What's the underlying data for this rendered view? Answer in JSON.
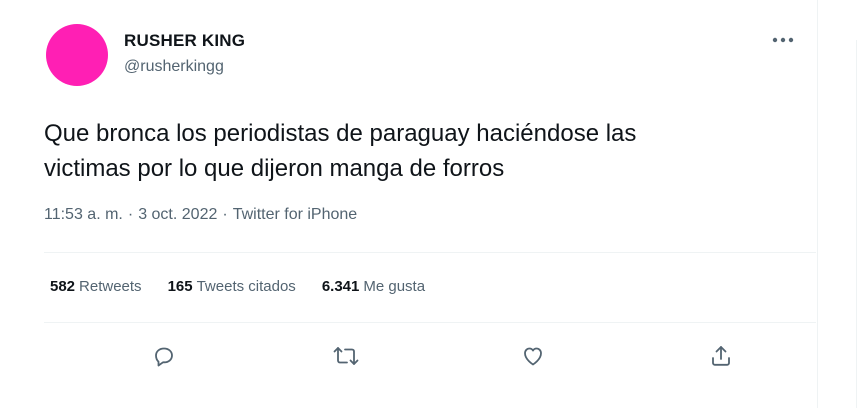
{
  "author": {
    "name": "RUSHER KING",
    "handle": "@rusherkingg",
    "avatar_color": "#ff1fb4"
  },
  "more_icon": "more-horizontal-icon",
  "tweet": {
    "text": "Que bronca los periodistas de paraguay haciéndose las\nvictimas por lo que dijeron manga de forros"
  },
  "meta": {
    "time": "11:53 a. m.",
    "separator": "·",
    "date": "3 oct. 2022",
    "client": "Twitter for iPhone"
  },
  "stats": {
    "retweets": {
      "count": "582",
      "label": "Retweets"
    },
    "quotes": {
      "count": "165",
      "label": "Tweets citados"
    },
    "likes": {
      "count": "6.341",
      "label": "Me gusta"
    }
  },
  "actions": {
    "icons": [
      "reply-icon",
      "retweet-icon",
      "like-icon",
      "share-icon"
    ],
    "icon_color": "#536471"
  }
}
